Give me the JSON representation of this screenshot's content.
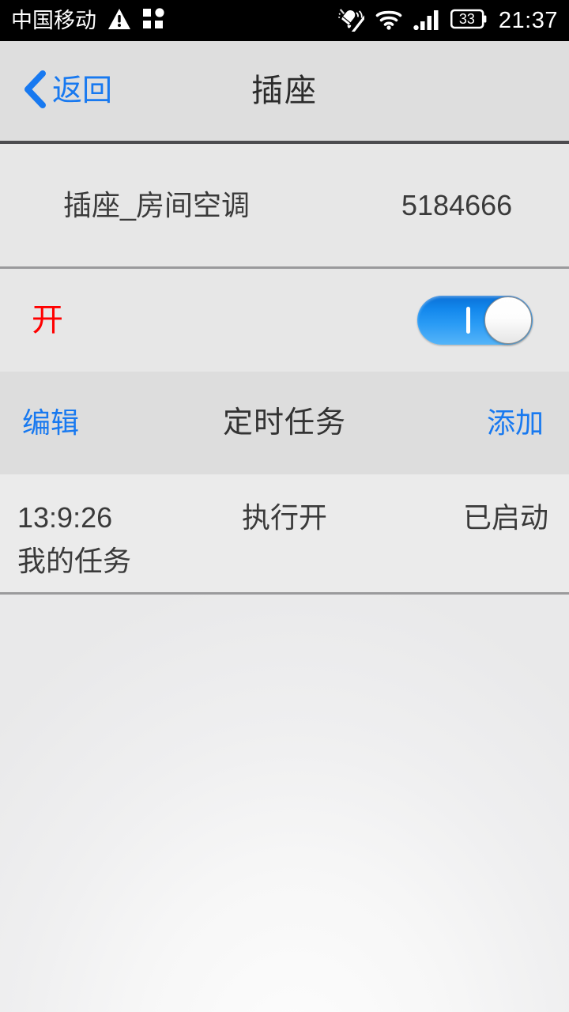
{
  "status_bar": {
    "carrier": "中国移动",
    "warning_icon": "warning-triangle-icon",
    "apps_icon": "app-grid-icon",
    "silent_icon": "bell-muted-icon",
    "wifi_icon": "wifi-icon",
    "signal_icon": "cellular-signal-icon",
    "battery_level": "33",
    "time": "21:37",
    "background_color": "#000000",
    "foreground_color": "#ffffff"
  },
  "nav_bar": {
    "back_label": "返回",
    "back_icon": "chevron-left-icon",
    "title": "插座",
    "accent_color": "#1879f0",
    "background_color": "#dedede"
  },
  "device": {
    "name": "插座_房间空调",
    "id": "5184666"
  },
  "power": {
    "state_label": "开",
    "state_color": "#ff0000",
    "toggle_on": true,
    "toggle_on_mark": "I",
    "toggle_track_color": "#1287ec"
  },
  "task_toolbar": {
    "edit_label": "编辑",
    "title": "定时任务",
    "add_label": "添加",
    "accent_color": "#1879f0",
    "background_color": "#dddddd"
  },
  "tasks": [
    {
      "time": "13:9:26",
      "action": "执行开",
      "status": "已启动",
      "name": "我的任务"
    }
  ]
}
